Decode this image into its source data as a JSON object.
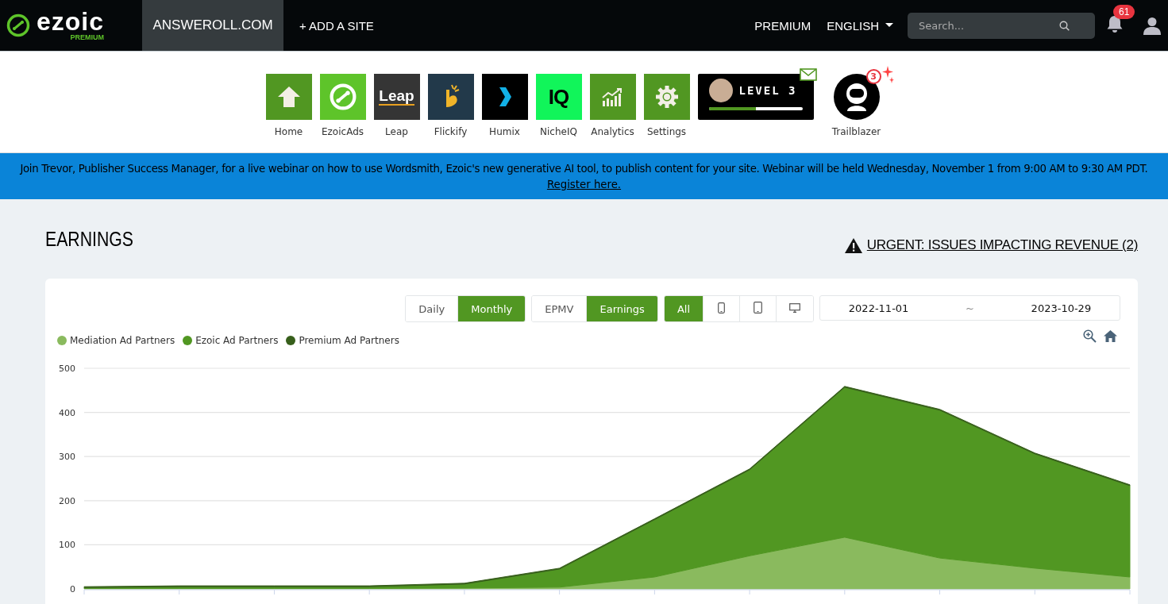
{
  "topbar": {
    "logo": {
      "wordmark": "ezoic",
      "tier": "PREMIUM"
    },
    "site": "ANSWEROLL.COM",
    "add_site": "+ ADD A SITE",
    "premium_link": "PREMIUM",
    "language": "ENGLISH",
    "search": {
      "placeholder": "Search..."
    },
    "notifications": "61"
  },
  "apps": [
    {
      "label": "Home",
      "color": "#519722",
      "kind": "home"
    },
    {
      "label": "EzoicAds",
      "color": "#5ec42a",
      "kind": "ezoic"
    },
    {
      "label": "Leap",
      "color": "#353535",
      "kind": "leap",
      "logo_text": "Leap"
    },
    {
      "label": "Flickify",
      "color": "#22394a",
      "kind": "flickify"
    },
    {
      "label": "Humix",
      "color": "#000000",
      "kind": "humix"
    },
    {
      "label": "NicheIQ",
      "color": "#11f55a",
      "kind": "nicheiq",
      "logo_text": "IQ"
    },
    {
      "label": "Analytics",
      "color": "#519722",
      "kind": "analytics"
    },
    {
      "label": "Settings",
      "color": "#519722",
      "kind": "settings"
    }
  ],
  "level_badge": {
    "label": "LEVEL 3",
    "level": 0.5
  },
  "trailblazer": {
    "label": "Trailblazer",
    "count": "3"
  },
  "banner": {
    "text": "Join Trevor, Publisher Success Manager, for a live webinar on how to use Wordsmith, Ezoic's new generative AI tool, to publish content for your site. Webinar will be held Wednesday, November 1 from 9:00 AM to 9:30 AM PDT.",
    "link": "Register here."
  },
  "page_title": "EARNINGS",
  "urgent_link": "URGENT: ISSUES IMPACTING REVENUE (2)",
  "period_toggle": [
    {
      "label": "Daily",
      "selected": false
    },
    {
      "label": "Monthly",
      "selected": true
    }
  ],
  "metric_toggle": [
    {
      "label": "EPMV",
      "selected": false
    },
    {
      "label": "Earnings",
      "selected": true
    }
  ],
  "device_toggle": [
    {
      "kind": "all",
      "label": "All",
      "selected": true
    },
    {
      "kind": "mobile",
      "selected": false
    },
    {
      "kind": "tablet",
      "selected": false
    },
    {
      "kind": "desktop",
      "selected": false
    }
  ],
  "date_range": {
    "start": "2022-11-01",
    "separator": "~",
    "end": "2023-10-29"
  },
  "chart_data": {
    "type": "area",
    "stacked": true,
    "grid": true,
    "ylim": [
      0,
      500
    ],
    "yticks": [
      0,
      100,
      200,
      300,
      400,
      500
    ],
    "series": [
      {
        "name": "Mediation Ad Partners",
        "color": "#8aba5e",
        "values": [
          1,
          1,
          1,
          1,
          2,
          4,
          27,
          75,
          117,
          70,
          47,
          27
        ]
      },
      {
        "name": "Ezoic Ad Partners",
        "color": "#519722",
        "values": [
          2,
          4,
          4,
          4,
          9,
          41,
          130,
          195,
          340,
          335,
          259,
          207
        ]
      },
      {
        "name": "Premium Ad Partners",
        "color": "#375f1b",
        "values": [
          2,
          2,
          2,
          2,
          2,
          2,
          2,
          2,
          2,
          2,
          2,
          2
        ]
      }
    ]
  }
}
